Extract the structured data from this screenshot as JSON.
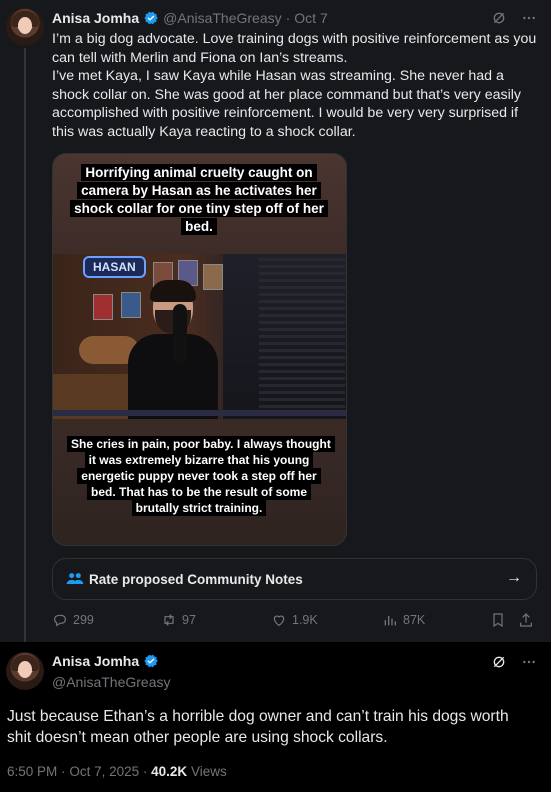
{
  "tweet1": {
    "author": "Anisa Jomha",
    "handle": "@AnisaTheGreasy",
    "separator": "·",
    "date": "Oct 7",
    "paragraph1": "I’m a big dog advocate. Love training dogs with positive reinforcement as you can tell with Merlin and Fiona on Ian’s streams.",
    "paragraph2": "I’ve met Kaya, I saw Kaya while Hasan was streaming. She never had a shock collar on. She was good at her place command but that’s very easily accomplished with positive reinforcement. I would be very very surprised if this was actually Kaya reacting to a shock collar.",
    "media": {
      "caption_top": "Horrifying animal cruelty caught on camera by Hasan as he activates her shock collar for one tiny step off of her bed.",
      "stream_logo": "HASAN",
      "caption_bottom": "She cries in pain, poor baby. I always thought it was extremely bizarre that his young energetic puppy never took a step off her bed. That has to be the result of some brutally strict training."
    },
    "community_notes_label": "Rate proposed Community Notes",
    "actions": {
      "replies": "299",
      "reposts": "97",
      "likes": "1.9K",
      "views": "87K"
    }
  },
  "tweet2": {
    "author": "Anisa Jomha",
    "handle": "@AnisaTheGreasy",
    "text": "Just because Ethan’s a horrible dog owner and can’t train his dogs worth shit doesn’t mean other people are using shock collars.",
    "time": "6:50 PM",
    "separator": "·",
    "date": "Oct 7, 2025",
    "separator2": "·",
    "views_count": "40.2K",
    "views_label": "Views"
  },
  "icons": {
    "verified": "verified-badge-icon",
    "grok": "grok-icon",
    "more": "more-icon",
    "community": "community-notes-icon",
    "arrow": "arrow-right-icon",
    "reply": "reply-icon",
    "repost": "repost-icon",
    "like": "like-icon",
    "views": "views-icon",
    "bookmark": "bookmark-icon",
    "share": "share-icon"
  },
  "colors": {
    "accent": "#1d9bf0",
    "background": "#000000",
    "card": "#16181c",
    "muted": "#71767b",
    "text": "#e7e9ea"
  }
}
